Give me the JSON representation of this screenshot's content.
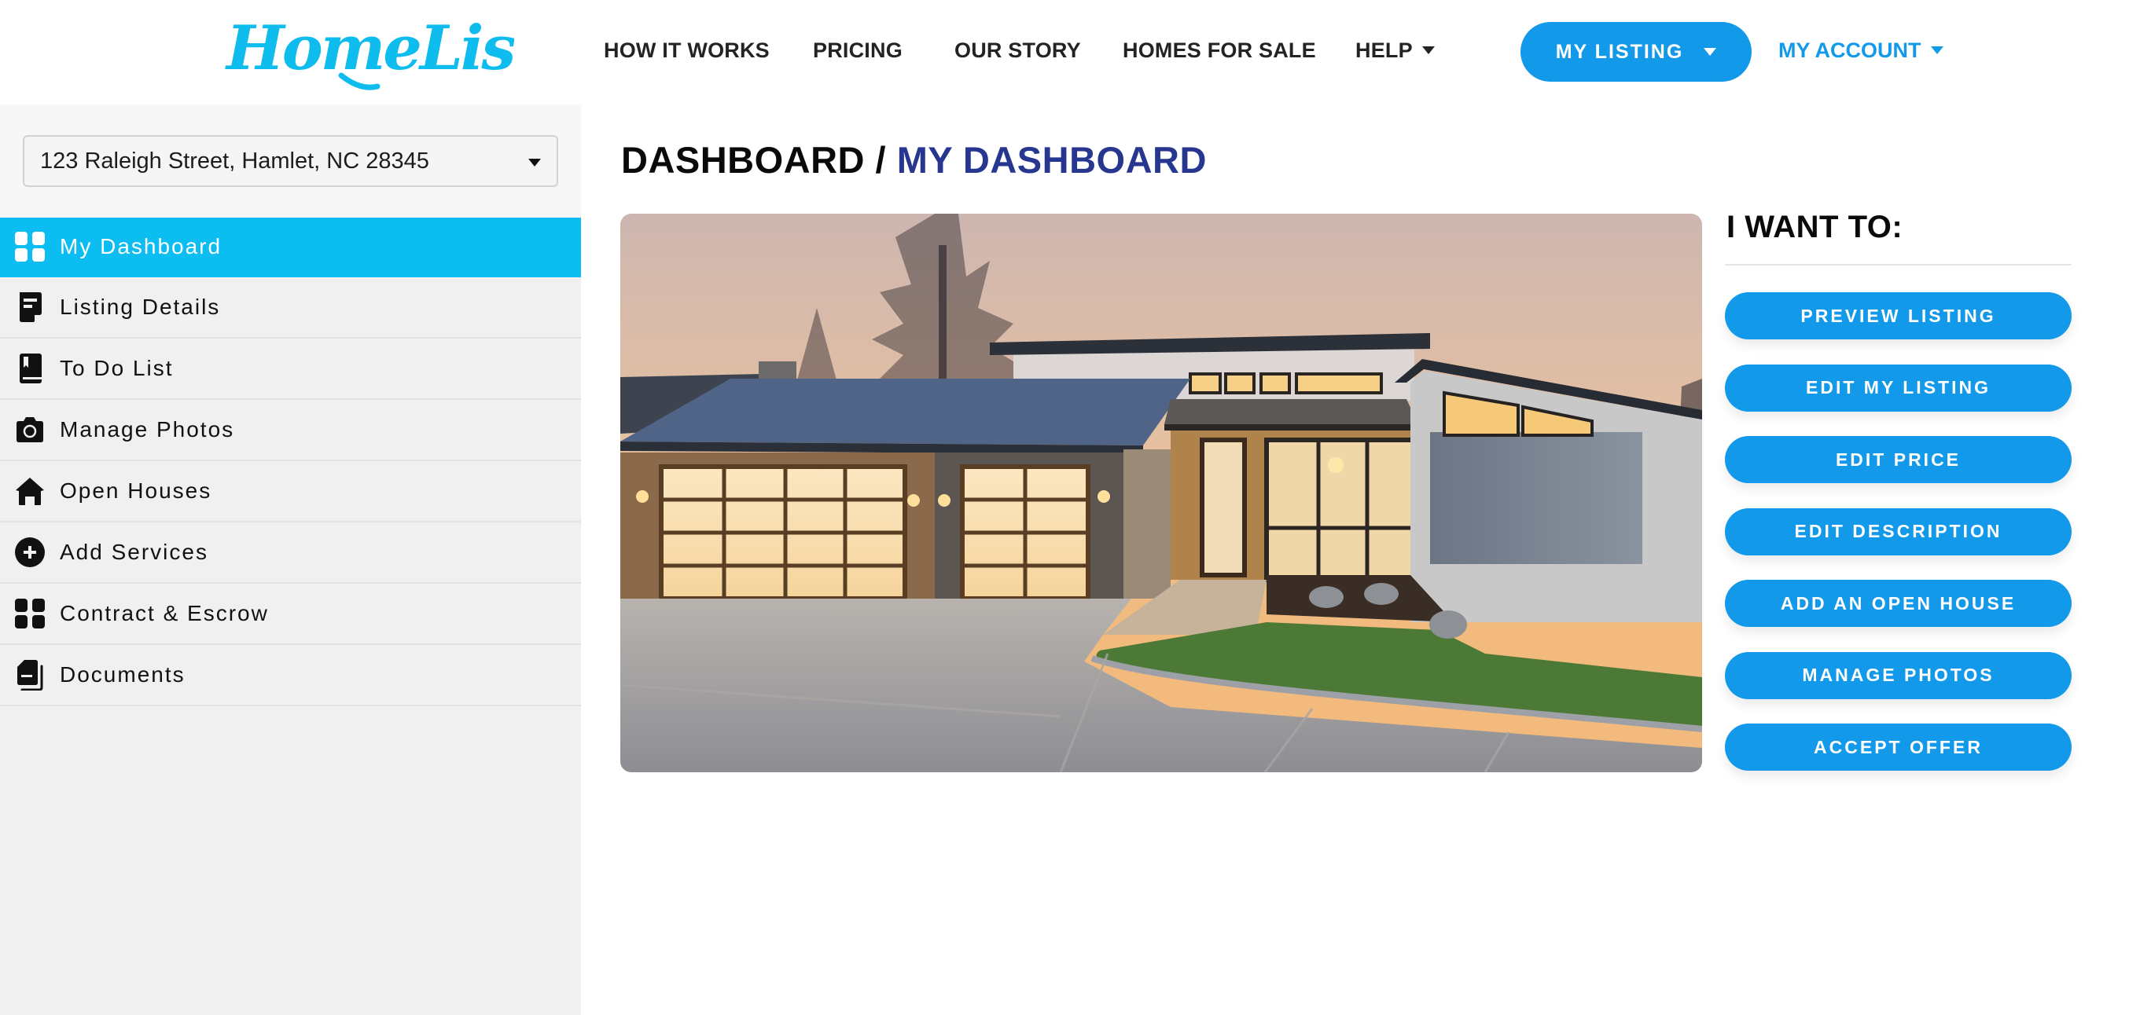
{
  "brand": {
    "name": "HomeLister",
    "color": "#0ebcee"
  },
  "header": {
    "nav": [
      {
        "label": "HOW IT WORKS",
        "has_dropdown": false
      },
      {
        "label": "PRICING",
        "has_dropdown": false
      },
      {
        "label": "OUR STORY",
        "has_dropdown": false
      },
      {
        "label": "HOMES FOR SALE",
        "has_dropdown": false
      },
      {
        "label": "HELP",
        "has_dropdown": true
      }
    ],
    "my_listing_label": "MY LISTING",
    "my_account_label": "MY ACCOUNT"
  },
  "sidebar": {
    "address_select": {
      "value": "123 Raleigh Street, Hamlet, NC 28345"
    },
    "items": [
      {
        "label": "My Dashboard",
        "icon": "grid-icon",
        "active": true
      },
      {
        "label": "Listing Details",
        "icon": "document-icon",
        "active": false
      },
      {
        "label": "To Do List",
        "icon": "bookmark-book-icon",
        "active": false
      },
      {
        "label": "Manage Photos",
        "icon": "camera-icon",
        "active": false
      },
      {
        "label": "Open Houses",
        "icon": "house-icon",
        "active": false
      },
      {
        "label": "Add Services",
        "icon": "plus-circle-icon",
        "active": false
      },
      {
        "label": "Contract & Escrow",
        "icon": "grid-icon",
        "active": false
      },
      {
        "label": "Documents",
        "icon": "documents-icon",
        "active": false
      }
    ]
  },
  "main": {
    "breadcrumb": {
      "root": "DASHBOARD",
      "separator": " / ",
      "current": "MY DASHBOARD"
    },
    "hero_image": {
      "alt": "Modern single-story home with glowing garage doors at dusk"
    },
    "actions": {
      "title": "I WANT TO:",
      "buttons": [
        "PREVIEW LISTING",
        "EDIT MY LISTING",
        "EDIT PRICE",
        "EDIT DESCRIPTION",
        "ADD AN OPEN HOUSE",
        "MANAGE PHOTOS",
        "ACCEPT OFFER"
      ]
    }
  },
  "colors": {
    "accent_blue": "#1399ea",
    "sidebar_active": "#0bbdf0",
    "breadcrumb_current": "#27368f"
  }
}
